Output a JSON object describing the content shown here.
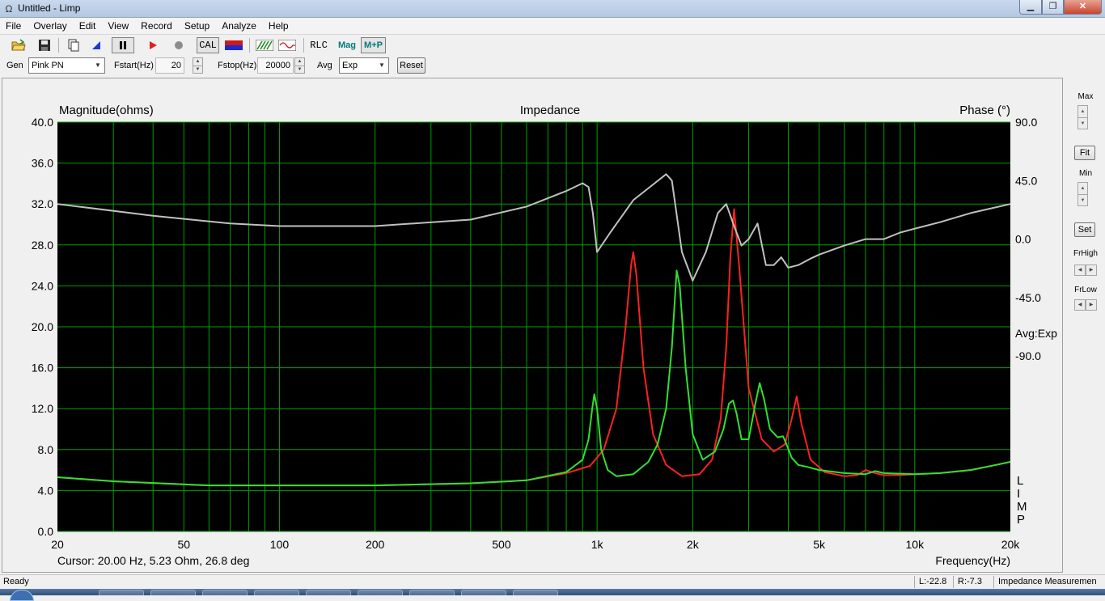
{
  "window": {
    "title": "Untitled - Limp",
    "app_icon": "Ω"
  },
  "menu": [
    "File",
    "Overlay",
    "Edit",
    "View",
    "Record",
    "Setup",
    "Analyze",
    "Help"
  ],
  "toolbar": {
    "cal_label": "CAL",
    "rlc_label": "RLC",
    "mag_label": "Mag",
    "mp_label": "M+P",
    "colors": {
      "record": "#e02020",
      "stop": "#8c8c8c",
      "mag": "#007a7a"
    }
  },
  "gen": {
    "gen_label": "Gen",
    "generator": "Pink PN",
    "fstart_label": "Fstart(Hz)",
    "fstart": "20",
    "fstop_label": "Fstop(Hz)",
    "fstop": "20000",
    "avg_label": "Avg",
    "avg": "Exp",
    "reset_label": "Reset"
  },
  "side": {
    "max_label": "Max",
    "fit_label": "Fit",
    "min_label": "Min",
    "set_label": "Set",
    "frhigh_label": "FrHigh",
    "frlow_label": "FrLow"
  },
  "status": {
    "ready": "Ready",
    "left": "L:-22.8",
    "right": "R:-7.3",
    "mode": "Impedance Measuremen"
  },
  "chart_data": {
    "type": "line",
    "title": "Impedance",
    "ylabel": "Magnitude(ohms)",
    "y2label": "Phase (°)",
    "xlabel": "Frequency(Hz)",
    "x_scale": "log",
    "xlim": [
      20,
      20000
    ],
    "ylim": [
      0,
      40
    ],
    "y2lim": [
      -225,
      90
    ],
    "grid": true,
    "background": "#000000",
    "grid_color": "#00a000",
    "x_ticks": [
      20,
      50,
      100,
      200,
      500,
      1000,
      2000,
      5000,
      10000,
      20000
    ],
    "x_tick_labels": [
      "20",
      "50",
      "100",
      "200",
      "500",
      "1k",
      "2k",
      "5k",
      "10k",
      "20k"
    ],
    "y_ticks": [
      0,
      4,
      8,
      12,
      16,
      20,
      24,
      28,
      32,
      36,
      40
    ],
    "y_tick_labels": [
      "0.0",
      "4.0",
      "8.0",
      "12.0",
      "16.0",
      "20.0",
      "24.0",
      "28.0",
      "32.0",
      "36.0",
      "40.0"
    ],
    "y2_ticks": [
      90,
      45,
      0,
      -45,
      -90
    ],
    "y2_tick_labels": [
      "90.0",
      "45.0",
      "0.0",
      "-45.0",
      "-90.0"
    ],
    "avg_text": "Avg:Exp",
    "limp_text": [
      "L",
      "I",
      "M",
      "P"
    ],
    "cursor_text": "Cursor: 20.00 Hz, 5.23 Ohm, 26.8 deg",
    "series": [
      {
        "color": "#ff2020",
        "axis": "magnitude",
        "x": [
          20,
          30,
          60,
          100,
          200,
          400,
          600,
          800,
          950,
          1050,
          1150,
          1230,
          1280,
          1300,
          1330,
          1400,
          1500,
          1650,
          1850,
          2100,
          2300,
          2450,
          2550,
          2630,
          2700,
          2800,
          3000,
          3300,
          3600,
          3900,
          4100,
          4250,
          4400,
          4700,
          5200,
          6000,
          6600,
          7000,
          7500,
          8000,
          9000,
          10000,
          12000,
          15000,
          18000,
          20000
        ],
        "values": [
          5.3,
          4.9,
          4.5,
          4.5,
          4.5,
          4.7,
          5.0,
          5.7,
          6.4,
          8.0,
          12.0,
          20.0,
          26.0,
          27.3,
          25.0,
          16.0,
          9.5,
          6.5,
          5.4,
          5.6,
          7.0,
          11.0,
          18.0,
          27.0,
          31.5,
          26.0,
          14.0,
          9.0,
          7.8,
          8.5,
          11.0,
          13.2,
          10.5,
          7.0,
          5.8,
          5.4,
          5.5,
          6.0,
          5.7,
          5.5,
          5.5,
          5.6,
          5.7,
          6.0,
          6.5,
          6.8
        ]
      },
      {
        "color": "#30e030",
        "axis": "magnitude",
        "x": [
          20,
          30,
          60,
          100,
          200,
          400,
          600,
          800,
          900,
          940,
          965,
          980,
          1000,
          1030,
          1080,
          1150,
          1300,
          1450,
          1550,
          1650,
          1720,
          1760,
          1780,
          1820,
          1900,
          2000,
          2150,
          2350,
          2500,
          2600,
          2680,
          2750,
          2850,
          3000,
          3150,
          3250,
          3350,
          3500,
          3700,
          3850,
          3950,
          4100,
          4300,
          4600,
          5000,
          6000,
          7000,
          7500,
          8000,
          10000,
          12000,
          15000,
          18000,
          20000
        ],
        "values": [
          5.3,
          4.9,
          4.5,
          4.5,
          4.5,
          4.7,
          5.0,
          5.8,
          7.0,
          9.0,
          12.0,
          13.4,
          12.0,
          8.0,
          6.0,
          5.4,
          5.6,
          6.8,
          8.5,
          12.0,
          18.0,
          23.0,
          25.5,
          24.0,
          16.0,
          9.5,
          7.0,
          7.8,
          10.0,
          12.5,
          12.8,
          11.5,
          9.0,
          9.0,
          12.5,
          14.5,
          13.0,
          10.0,
          9.2,
          9.3,
          8.5,
          7.2,
          6.5,
          6.3,
          6.0,
          5.7,
          5.6,
          5.9,
          5.7,
          5.6,
          5.7,
          6.0,
          6.5,
          6.8
        ]
      },
      {
        "color": "#c0c0c0",
        "axis": "phase",
        "x": [
          20,
          40,
          70,
          100,
          200,
          400,
          600,
          800,
          900,
          940,
          970,
          1000,
          1100,
          1300,
          1500,
          1650,
          1720,
          1850,
          2000,
          2200,
          2400,
          2550,
          2700,
          2850,
          3000,
          3200,
          3400,
          3600,
          3800,
          4000,
          4300,
          4700,
          5000,
          6000,
          7000,
          8000,
          9000,
          10000,
          12000,
          15000,
          20000
        ],
        "values": [
          27,
          18,
          12,
          10,
          10,
          15,
          25,
          37,
          43,
          40,
          20,
          -10,
          5,
          30,
          42,
          50,
          45,
          -10,
          -32,
          -10,
          20,
          27,
          10,
          -5,
          0,
          12,
          -20,
          -20,
          -14,
          -22,
          -20,
          -15,
          -12,
          -5,
          0,
          0,
          5,
          8,
          13,
          20,
          27
        ]
      }
    ]
  }
}
